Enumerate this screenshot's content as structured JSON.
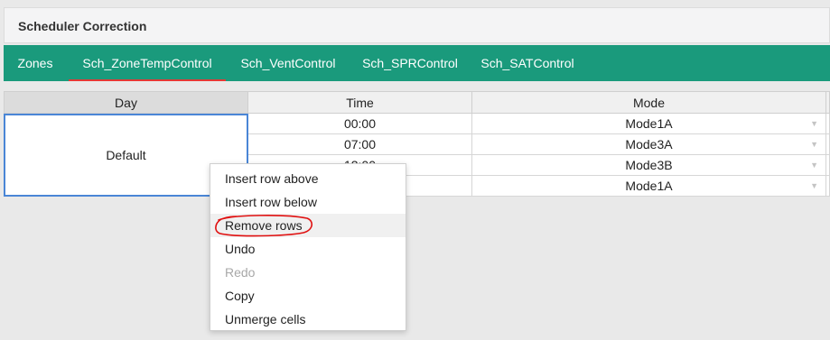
{
  "header": {
    "title": "Scheduler Correction"
  },
  "tabs": [
    {
      "label": "Zones",
      "active": false
    },
    {
      "label": "Sch_ZoneTempControl",
      "active": true
    },
    {
      "label": "Sch_VentControl",
      "active": false
    },
    {
      "label": "Sch_SPRControl",
      "active": false
    },
    {
      "label": "Sch_SATControl",
      "active": false
    }
  ],
  "grid": {
    "columns": [
      "Day",
      "Time",
      "Mode"
    ],
    "day_value": "Default",
    "rows": [
      {
        "time": "00:00",
        "mode": "Mode1A"
      },
      {
        "time": "07:00",
        "mode": "Mode3A"
      },
      {
        "time": "12:00",
        "mode": "Mode3B"
      },
      {
        "time": "",
        "mode": "Mode1A"
      }
    ],
    "dropdown_glyph": "▼"
  },
  "context_menu": {
    "items": [
      {
        "label": "Insert row above",
        "disabled": false
      },
      {
        "label": "Insert row below",
        "disabled": false
      },
      {
        "label": "Remove rows",
        "disabled": false,
        "highlighted": true
      },
      {
        "label": "Undo",
        "disabled": false
      },
      {
        "label": "Redo",
        "disabled": true
      },
      {
        "label": "Copy",
        "disabled": false
      },
      {
        "label": "Unmerge cells",
        "disabled": false
      }
    ]
  },
  "colors": {
    "tab_bar": "#1a9a7c",
    "active_underline": "#e53935",
    "selection_border": "#4a86d6",
    "annotation": "#e01010"
  }
}
